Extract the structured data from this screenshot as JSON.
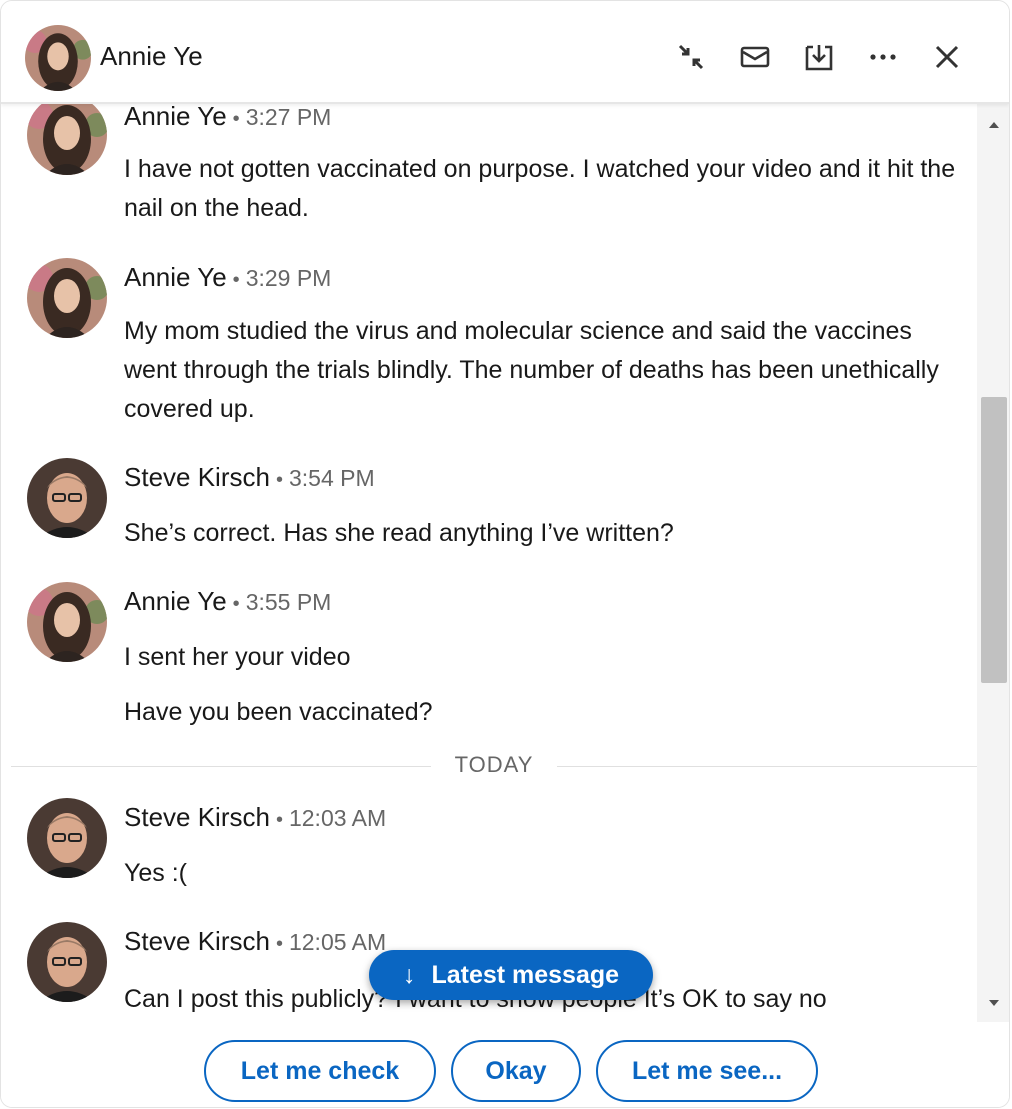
{
  "header": {
    "name": "Annie Ye",
    "actions": [
      {
        "icon": "compress-icon"
      },
      {
        "icon": "envelope-icon"
      },
      {
        "icon": "download-icon"
      },
      {
        "icon": "more-icon"
      },
      {
        "icon": "close-icon"
      }
    ]
  },
  "messages": [
    {
      "name": "Annie Ye",
      "dot": "•",
      "time": "3:27 PM",
      "avatar": "annie",
      "lines": [
        "I have not gotten vaccinated on purpose. I watched your video and it hit the nail on the head."
      ]
    },
    {
      "name": "Annie Ye",
      "dot": "•",
      "time": "3:29 PM",
      "avatar": "annie",
      "lines": [
        "My mom studied the virus and molecular science and said the vaccines went through the trials blindly. The number of deaths has been unethically covered up."
      ]
    },
    {
      "name": "Steve Kirsch",
      "dot": "•",
      "time": "3:54 PM",
      "avatar": "steve",
      "lines": [
        "She’s correct. Has she read anything I’ve written?"
      ]
    },
    {
      "name": "Annie Ye",
      "dot": "•",
      "time": "3:55 PM",
      "avatar": "annie",
      "lines": [
        "I sent her your video",
        "Have you been vaccinated?"
      ]
    },
    {
      "name": "Steve Kirsch",
      "dot": "•",
      "time": "12:03 AM",
      "avatar": "steve",
      "lines": [
        "Yes :("
      ]
    },
    {
      "name": "Steve Kirsch",
      "dot": "•",
      "time": "12:05 AM",
      "avatar": "steve",
      "lines": [
        "Can I post this publicly? I want to show people It’s OK to say no"
      ]
    }
  ],
  "divider": {
    "label": "TODAY"
  },
  "latest_button": {
    "label": "Latest message",
    "arrow": "↓"
  },
  "suggestions": [
    "Let me check",
    "Okay",
    "Let me see..."
  ],
  "colors": {
    "accent": "#0a66c2",
    "text": "#191919",
    "muted": "#666666"
  }
}
